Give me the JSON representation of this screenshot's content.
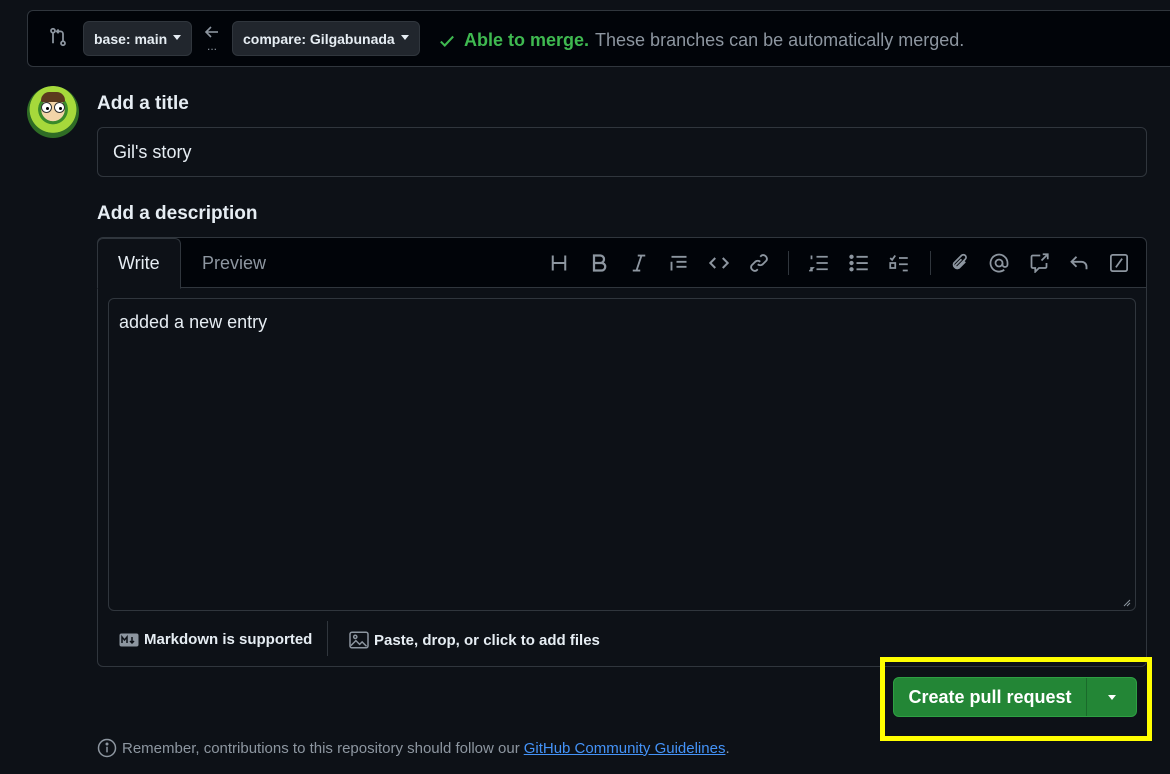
{
  "compare": {
    "base_label": "base: main",
    "compare_label": "compare: Gilgabunada",
    "swap_dots": "...",
    "status_ok": "Able to merge.",
    "status_text": "These branches can be automatically merged."
  },
  "form": {
    "title_label": "Add a title",
    "title_value": "Gil's story",
    "description_label": "Add a description",
    "tabs": [
      "Write",
      "Preview"
    ],
    "body_value": "added a new entry",
    "toolbar_icons": [
      "heading-icon",
      "bold-icon",
      "italic-icon",
      "quote-icon",
      "code-icon",
      "link-icon",
      "numbered-list-icon",
      "unordered-list-icon",
      "task-list-icon",
      "attach-icon",
      "mention-icon",
      "cross-reference-icon",
      "saved-replies-icon",
      "slash-commands-icon"
    ]
  },
  "footer": {
    "markdown_text": "Markdown is supported",
    "attach_text": "Paste, drop, or click to add files"
  },
  "actions": {
    "create_label": "Create pull request"
  },
  "note": {
    "text": "Remember, contributions to this repository should follow our",
    "link_text": "GitHub Community Guidelines",
    "trailing": "."
  },
  "colors": {
    "background": "#0d1117",
    "accent_green": "#238636",
    "merge_ok": "#3fb950",
    "link": "#4493f8",
    "highlight": "#ffff00"
  }
}
